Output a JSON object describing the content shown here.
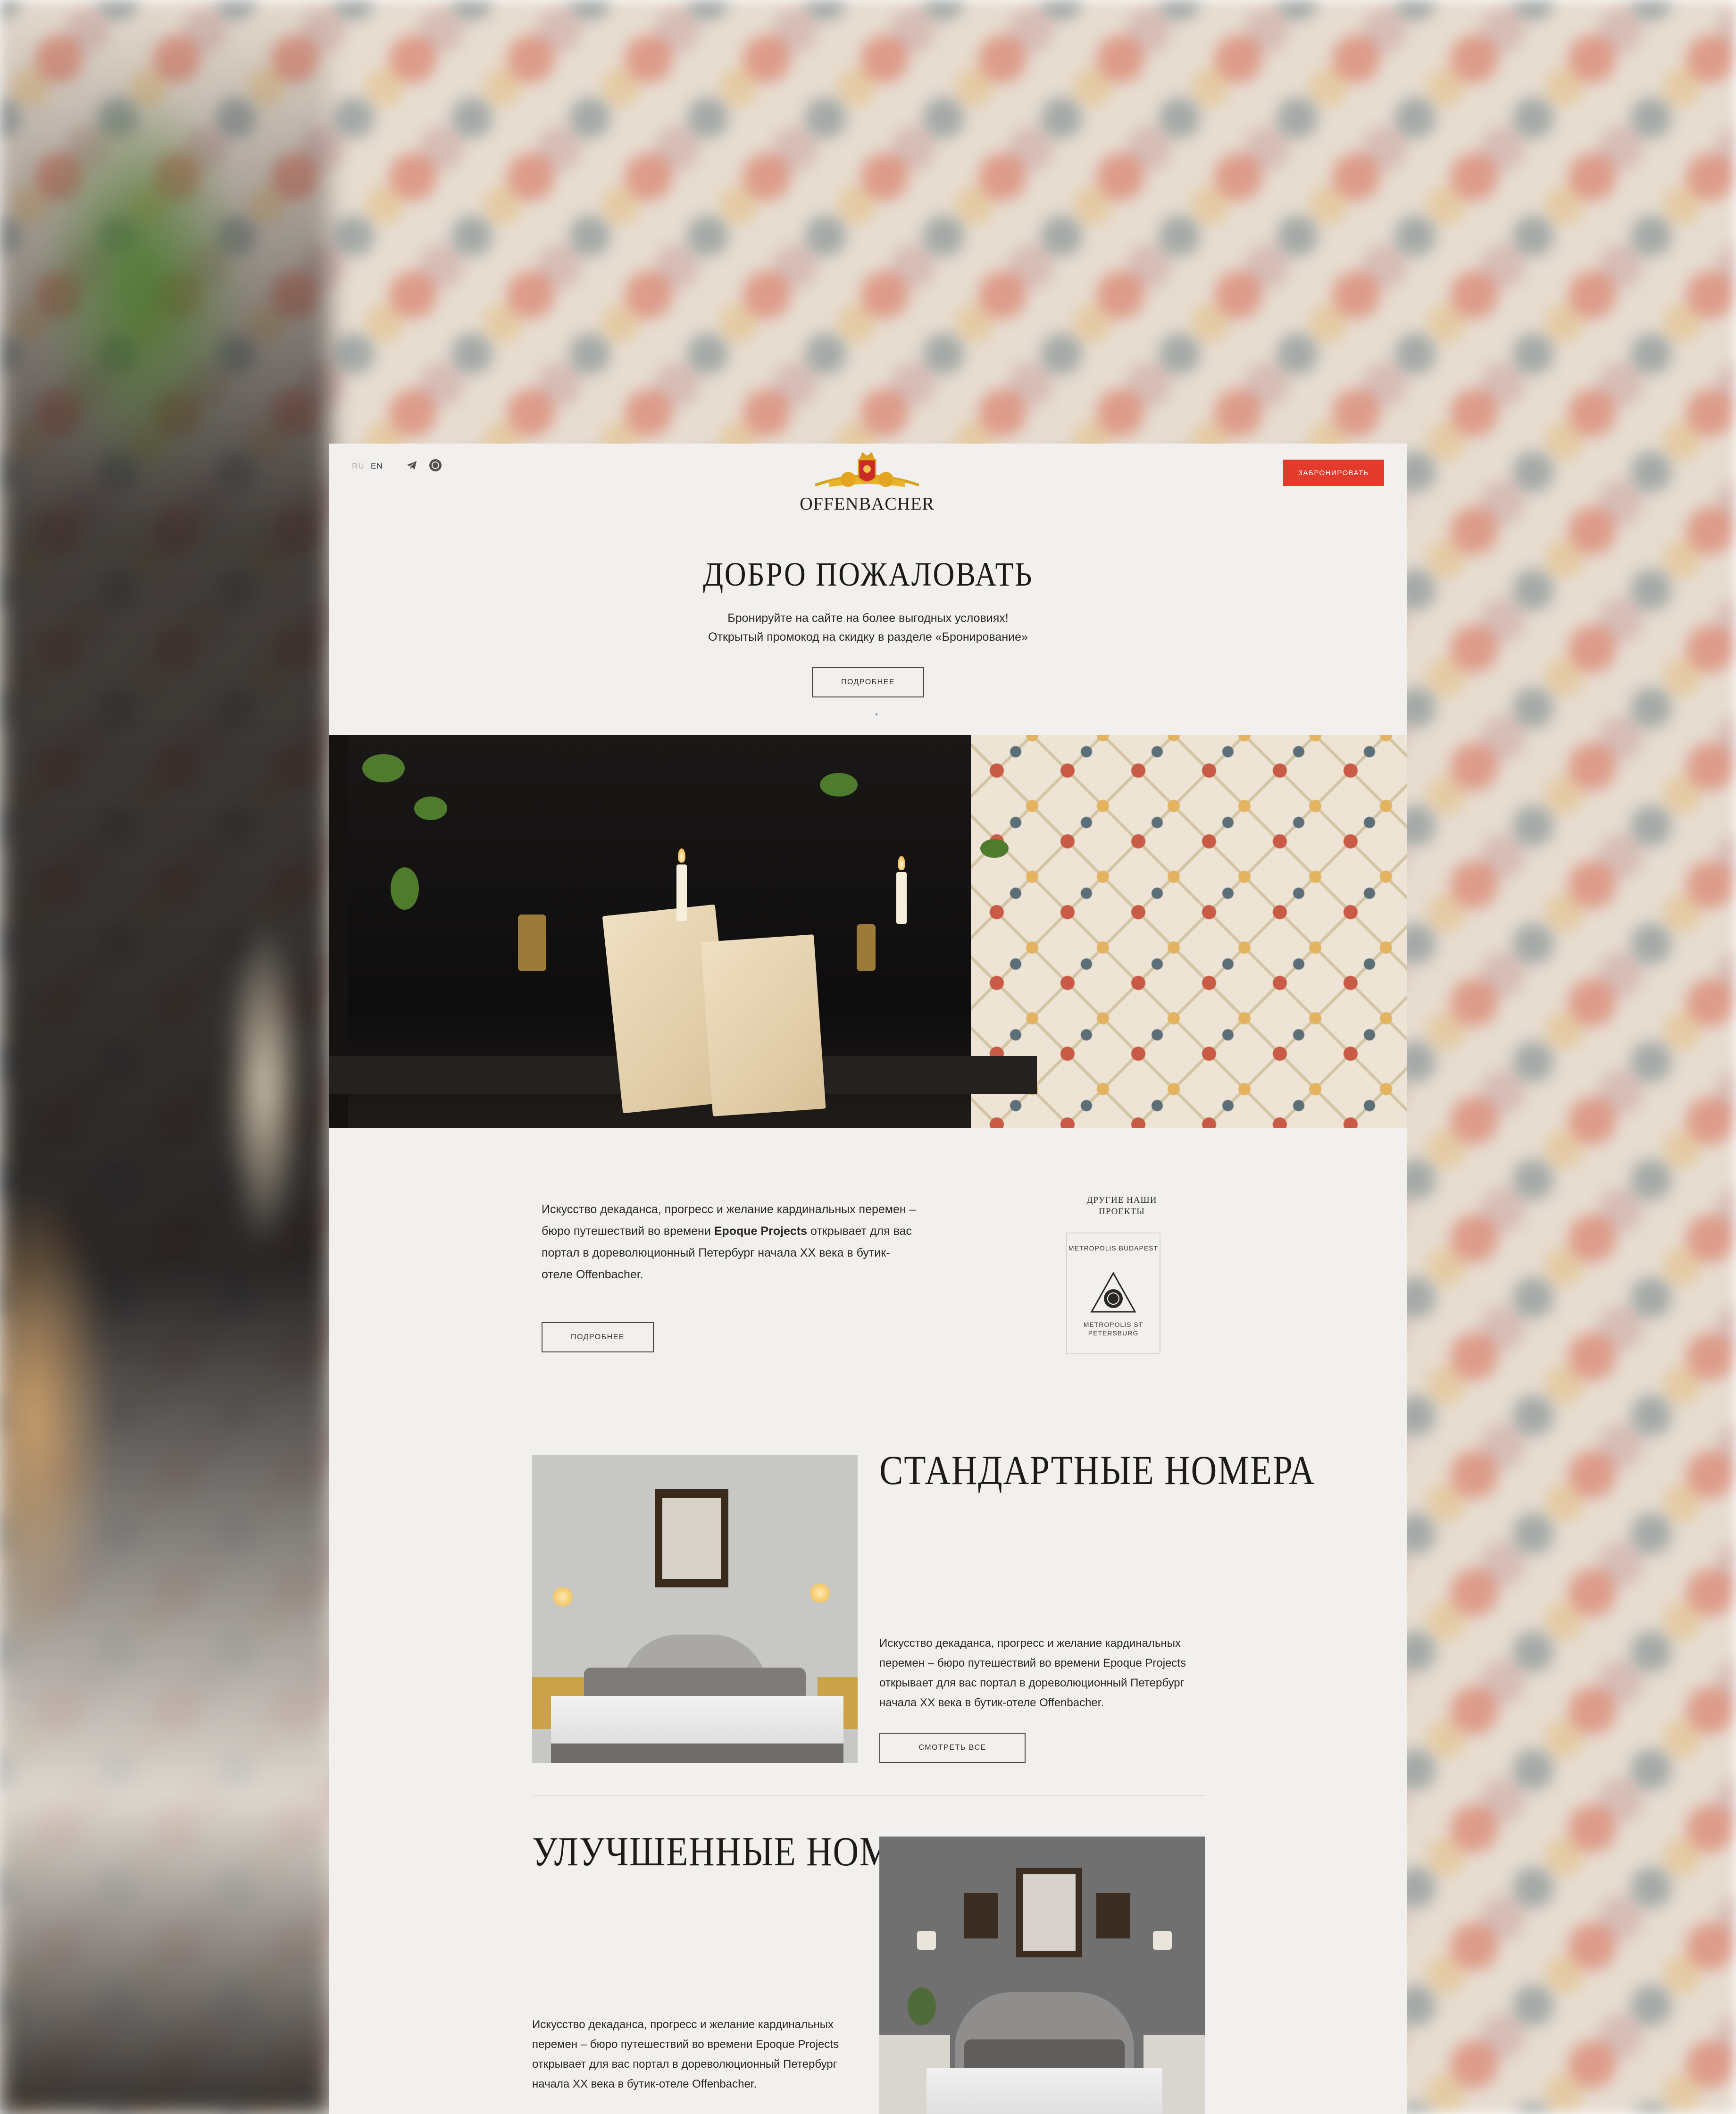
{
  "header": {
    "lang_ru": "RU",
    "lang_en": "EN",
    "telegram_icon": "telegram-icon",
    "whatsapp_icon": "whatsapp-icon",
    "logo_text": "OFFENBACHER",
    "book_label": "ЗАБРОНИРОВАТЬ"
  },
  "hero": {
    "title": "ДОБРО ПОЖАЛОВАТЬ",
    "line1": "Бронируйте на сайте на более выгодных условиях!",
    "line2": "Открытый промокод на скидку в разделе «Бронирование»",
    "more_label": "ПОДРОБНЕЕ"
  },
  "about": {
    "text_before": "Искусство декаданса, прогресс и желание кардинальных перемен – бюро путешествий во времени ",
    "text_bold": "Epoque Projects",
    "text_after": " открывает для вас портал в дореволюционный Петербург начала XX века в бутик-отеле Offenbacher.",
    "more_label": "ПОДРОБНЕЕ",
    "projects_title": "ДРУГИЕ НАШИ ПРОЕКТЫ",
    "project_top": "METROPOLIS BUDAPEST",
    "project_bottom": "METROPOLIS ST PETERSBURG"
  },
  "rooms": [
    {
      "title": "СТАНДАРТНЫЕ НОМЕРА",
      "desc": "Искусство декаданса, прогресс и желание кардинальных перемен – бюро путешествий во времени Epoque Projects открывает для вас портал в дореволюционный Петербург начала XX века в бутик-отеле Offenbacher.",
      "button": "СМОТРЕТЬ ВСЕ"
    },
    {
      "title": "УЛУЧШЕННЫЕ НОМЕРА",
      "desc": "Искусство декаданса, прогресс и желание кардинальных перемен – бюро путешествий во времени Epoque Projects открывает для вас портал в дореволюционный Петербург начала XX века в бутик-отеле Offenbacher."
    }
  ],
  "colors": {
    "accent": "#e23b2c",
    "panel": "#f1f0ee",
    "text": "#2a2826"
  }
}
